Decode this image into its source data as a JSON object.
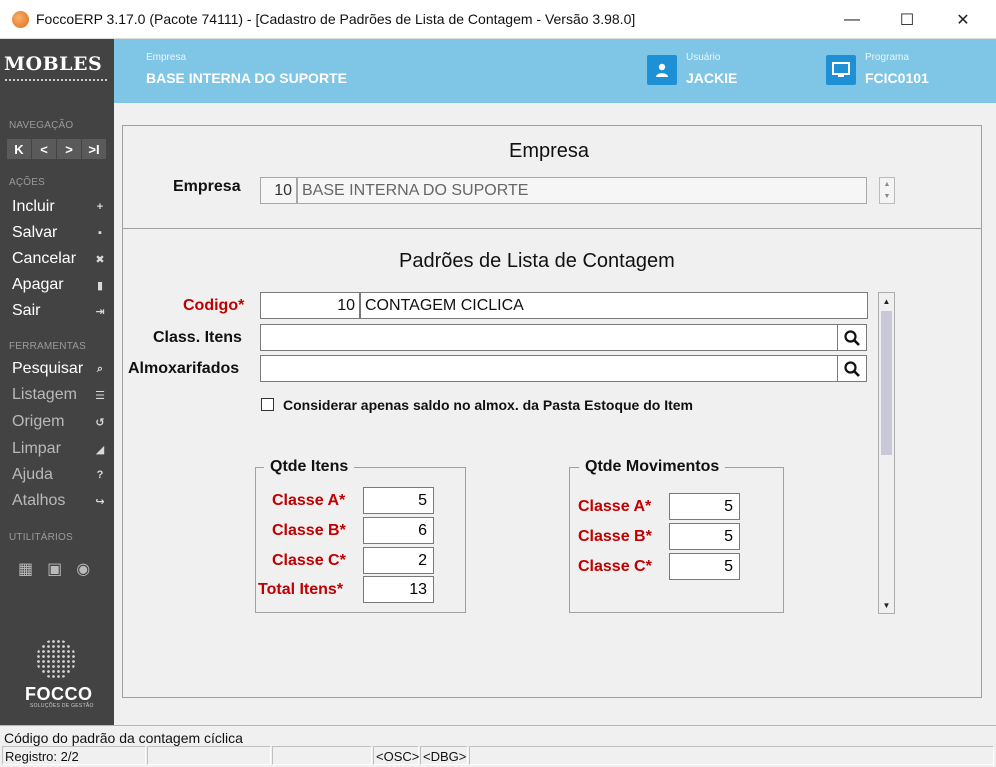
{
  "window": {
    "title": "FoccoERP 3.17.0 (Pacote 74111) - [Cadastro de Padrões de Lista de Contagem - Versão 3.98.0]",
    "minimize": "—",
    "maximize": "☐",
    "close": "✕"
  },
  "header": {
    "logo": "MOBLES",
    "empresa_caption": "Empresa",
    "empresa_value": "BASE INTERNA DO SUPORTE",
    "usuario_caption": "Usuário",
    "usuario_value": "JACKIE",
    "programa_caption": "Programa",
    "programa_value": "FCIC0101",
    "bg_color": "#7ec5e6"
  },
  "sidebar": {
    "nav_section": "NAVEGAÇÃO",
    "nav_buttons": [
      "K",
      "<",
      ">",
      ">I"
    ],
    "acoes_section": "AÇÕES",
    "acoes": [
      {
        "label": "Incluir",
        "icon": "+"
      },
      {
        "label": "Salvar",
        "icon": "▪"
      },
      {
        "label": "Cancelar",
        "icon": "✖"
      },
      {
        "label": "Apagar",
        "icon": "▮"
      },
      {
        "label": "Sair",
        "icon": "⇥"
      }
    ],
    "ferramentas_section": "FERRAMENTAS",
    "ferramentas": [
      {
        "label": "Pesquisar",
        "icon": "⌕"
      },
      {
        "label": "Listagem",
        "icon": "☰"
      },
      {
        "label": "Origem",
        "icon": "↺"
      },
      {
        "label": "Limpar",
        "icon": "◢"
      },
      {
        "label": "Ajuda",
        "icon": "?"
      },
      {
        "label": "Atalhos",
        "icon": "↪"
      }
    ],
    "utilitarios_section": "UTILITÁRIOS",
    "utilitarios_icons": [
      "▦",
      "▣",
      "◉"
    ],
    "brand": "FOCCO",
    "brand_sub": "SOLUÇÕES DE GESTÃO"
  },
  "empresa_section": {
    "title": "Empresa",
    "label": "Empresa",
    "code": "10",
    "name": "BASE INTERNA DO SUPORTE"
  },
  "padroes_section": {
    "title": "Padrões de Lista de Contagem",
    "codigo_label": "Codigo*",
    "codigo_value": "10",
    "codigo_desc": "CONTAGEM CICLICA",
    "class_itens_label": "Class. Itens",
    "class_itens_value": "",
    "almoxarifados_label": "Almoxarifados",
    "almoxarifados_value": "",
    "considerar_label": "Considerar apenas saldo no almox. da Pasta Estoque do Item",
    "considerar_checked": false
  },
  "qtde_itens": {
    "title": "Qtde Itens",
    "rows": [
      {
        "label": "Classe A*",
        "value": "5"
      },
      {
        "label": "Classe B*",
        "value": "6"
      },
      {
        "label": "Classe C*",
        "value": "2"
      },
      {
        "label": "Total Itens*",
        "value": "13"
      }
    ]
  },
  "qtde_movimentos": {
    "title": "Qtde Movimentos",
    "rows": [
      {
        "label": "Classe A*",
        "value": "5"
      },
      {
        "label": "Classe B*",
        "value": "5"
      },
      {
        "label": "Classe C*",
        "value": "5"
      }
    ]
  },
  "statusbar": {
    "message": "Código do padrão da contagem cíclica",
    "registro": "Registro: 2/2",
    "osc": "<OSC>",
    "dbg": "<DBG>"
  },
  "colors": {
    "required": "#c00000",
    "sidebar": "#434343",
    "accent": "#1e90d6"
  }
}
